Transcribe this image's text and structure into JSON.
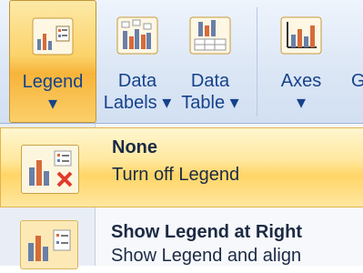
{
  "ribbon": {
    "buttons": [
      {
        "label": "Legend",
        "label2": "▾",
        "icon": "legend-icon"
      },
      {
        "label": "Data",
        "label2": "Labels ▾",
        "icon": "data-labels-icon"
      },
      {
        "label": "Data",
        "label2": "Table ▾",
        "icon": "data-table-icon"
      },
      {
        "label": "Axes",
        "label2": "▾",
        "icon": "axes-icon"
      },
      {
        "label": "G",
        "label2": "",
        "icon": "gridlines-icon"
      }
    ]
  },
  "menu": {
    "items": [
      {
        "title": "None",
        "description": "Turn off Legend",
        "icon": "legend-none-icon"
      },
      {
        "title": "Show Legend at Right",
        "description": "Show Legend and align",
        "icon": "legend-right-icon"
      }
    ]
  },
  "colors": {
    "accent": "#f7b43a",
    "text": "#15428b"
  }
}
